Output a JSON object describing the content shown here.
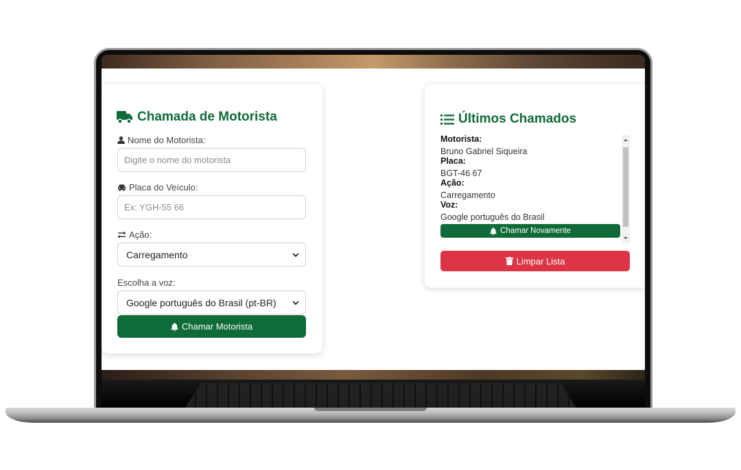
{
  "left_card": {
    "title": "Chamada de Motorista",
    "driver_label": "Nome do Motorista:",
    "driver_placeholder": "Digite o nome do motorista",
    "plate_label": "Placa do Veículo:",
    "plate_placeholder": "Ex: YGH-55 66",
    "action_label": "Ação:",
    "action_value": "Carregamento",
    "voice_label": "Escolha a voz:",
    "voice_value": "Google português do Brasil (pt-BR)",
    "call_button": "Chamar Motorista"
  },
  "right_card": {
    "title": "Últimos Chamados",
    "entries": [
      {
        "driver_key": "Motorista:",
        "driver": "Bruno Gabriel Siqueira",
        "plate_key": "Placa:",
        "plate": "BGT-46 67",
        "action_key": "Ação:",
        "action": "Carregamento",
        "voice_key": "Voz:",
        "voice": "Google português do Brasil",
        "recall_button": "Chamar Novamente"
      }
    ],
    "clear_button": "Limpar Lista"
  },
  "colors": {
    "brand_green": "#0f6b37",
    "danger_red": "#dc3545"
  }
}
